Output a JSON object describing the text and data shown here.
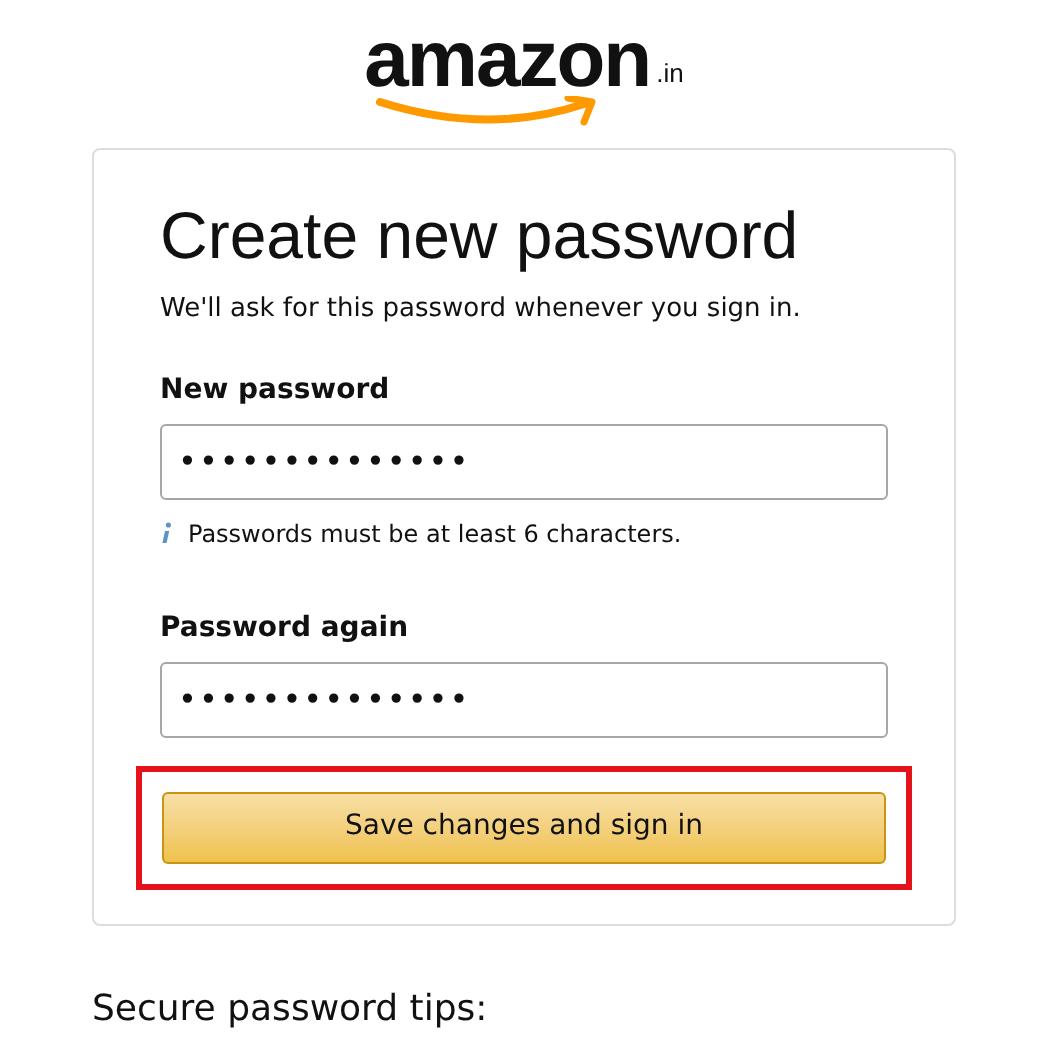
{
  "logo": {
    "wordmark": "amazon",
    "suffix": ".in"
  },
  "card": {
    "title": "Create new password",
    "subtitle": "We'll ask for this password whenever you sign in.",
    "fields": [
      {
        "label": "New password",
        "value": "••••••••••••••",
        "hint": "Passwords must be at least 6 characters."
      },
      {
        "label": "Password again",
        "value": "••••••••••••••"
      }
    ],
    "button": {
      "label": "Save changes and sign in",
      "highlighted": true
    }
  },
  "tips_heading": "Secure password tips:"
}
